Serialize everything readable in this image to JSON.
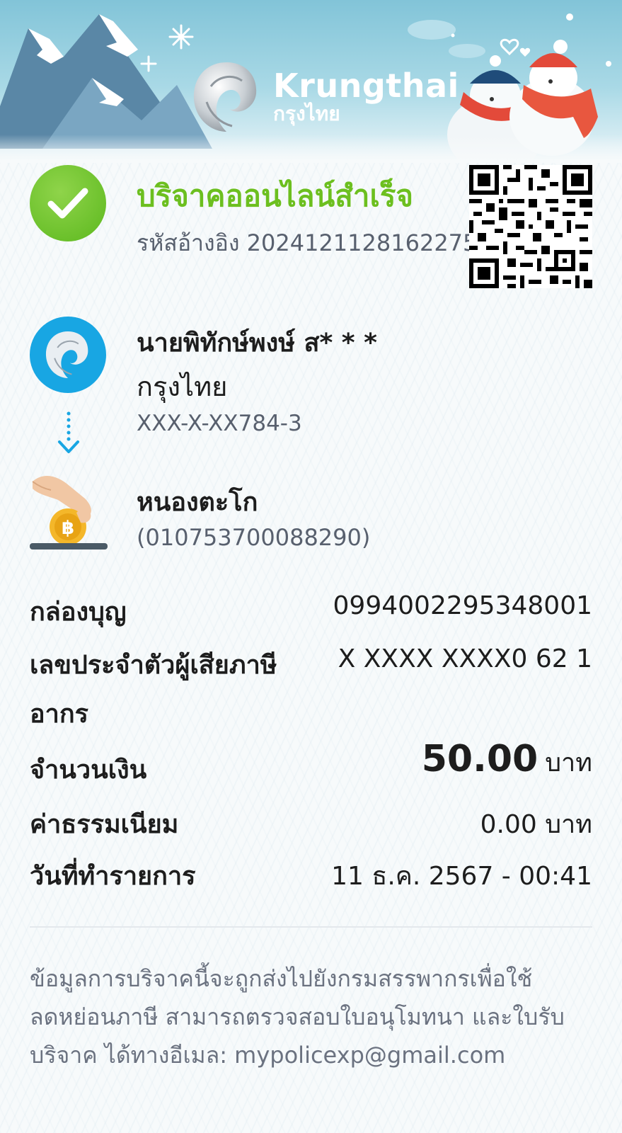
{
  "header": {
    "brand_en": "Krungthai",
    "brand_th": "กรุงไทย"
  },
  "status": {
    "title": "บริจาคออนไลน์สำเร็จ",
    "ref_label": "รหัสอ้างอิง",
    "ref_number": "2024121128162275"
  },
  "from": {
    "name": "นายพิทักษ์พงษ์ ส* * *",
    "bank": "กรุงไทย",
    "account": "XXX-X-XX784-3"
  },
  "to": {
    "name": "หนองตะโก",
    "id": "(010753700088290)"
  },
  "details": {
    "box_label": "กล่องบุญ",
    "box_value": "0994002295348001",
    "taxid_label_line1": "เลขประจำตัวผู้เสียภาษี",
    "taxid_label_line2": "อากร",
    "taxid_value": "X XXXX XXXX0 62 1",
    "amount_label": "จำนวนเงิน",
    "amount_value": "50.00",
    "amount_unit": "บาท",
    "fee_label": "ค่าธรรมเนียม",
    "fee_value": "0.00 บาท",
    "date_label": "วันที่ทำรายการ",
    "date_value": "11 ธ.ค. 2567 - 00:41"
  },
  "footer": {
    "line1": "ข้อมูลการบริจาคนี้จะถูกส่งไปยังกรมสรรพากรเพื่อใช้",
    "line2": "ลดหย่อนภาษี สามารถตรวจสอบใบอนุโมทนา และใบรับ",
    "line3": "บริจาค ได้ทางอีเมล: mypolicexp@gmail.com"
  },
  "colors": {
    "success_green": "#6cbf1f",
    "brand_blue": "#18a6e3",
    "muted_text": "#58606e"
  }
}
